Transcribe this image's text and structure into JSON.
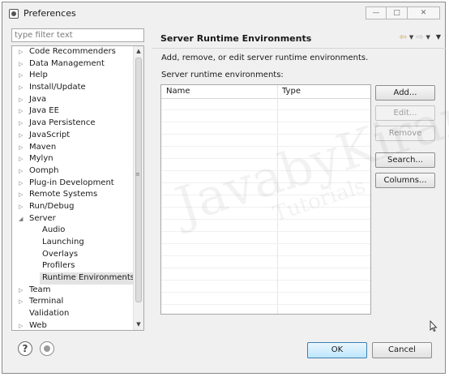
{
  "window": {
    "title": "Preferences",
    "icon": "preferences-app-icon",
    "controls": [
      "minimize",
      "maximize",
      "close"
    ]
  },
  "filter": {
    "placeholder": "type filter text",
    "value": ""
  },
  "tree": {
    "items": [
      {
        "label": "Code Recommenders",
        "expander": "collapsed",
        "level": 0
      },
      {
        "label": "Data Management",
        "expander": "collapsed",
        "level": 0
      },
      {
        "label": "Help",
        "expander": "collapsed",
        "level": 0
      },
      {
        "label": "Install/Update",
        "expander": "collapsed",
        "level": 0
      },
      {
        "label": "Java",
        "expander": "collapsed",
        "level": 0
      },
      {
        "label": "Java EE",
        "expander": "collapsed",
        "level": 0
      },
      {
        "label": "Java Persistence",
        "expander": "collapsed",
        "level": 0
      },
      {
        "label": "JavaScript",
        "expander": "collapsed",
        "level": 0
      },
      {
        "label": "Maven",
        "expander": "collapsed",
        "level": 0
      },
      {
        "label": "Mylyn",
        "expander": "collapsed",
        "level": 0
      },
      {
        "label": "Oomph",
        "expander": "collapsed",
        "level": 0
      },
      {
        "label": "Plug-in Development",
        "expander": "collapsed",
        "level": 0
      },
      {
        "label": "Remote Systems",
        "expander": "collapsed",
        "level": 0
      },
      {
        "label": "Run/Debug",
        "expander": "collapsed",
        "level": 0
      },
      {
        "label": "Server",
        "expander": "expanded",
        "level": 0
      },
      {
        "label": "Audio",
        "expander": "none",
        "level": 1
      },
      {
        "label": "Launching",
        "expander": "none",
        "level": 1
      },
      {
        "label": "Overlays",
        "expander": "none",
        "level": 1
      },
      {
        "label": "Profilers",
        "expander": "none",
        "level": 1
      },
      {
        "label": "Runtime Environments",
        "expander": "none",
        "level": 1,
        "selected": true
      },
      {
        "label": "Team",
        "expander": "collapsed",
        "level": 0
      },
      {
        "label": "Terminal",
        "expander": "collapsed",
        "level": 0
      },
      {
        "label": "Validation",
        "expander": "none",
        "level": 0
      },
      {
        "label": "Web",
        "expander": "collapsed",
        "level": 0
      }
    ]
  },
  "page": {
    "title": "Server Runtime Environments",
    "description": "Add, remove, or edit server runtime environments.",
    "list_label": "Server runtime environments:",
    "columns": [
      "Name",
      "Type"
    ],
    "rows": []
  },
  "buttons": {
    "add": "Add...",
    "edit": "Edit...",
    "remove": "Remove",
    "search": "Search...",
    "columns": "Columns...",
    "ok": "OK",
    "cancel": "Cancel"
  },
  "watermark": {
    "main": "JavabyKiran",
    "sub": "Tutorials"
  }
}
